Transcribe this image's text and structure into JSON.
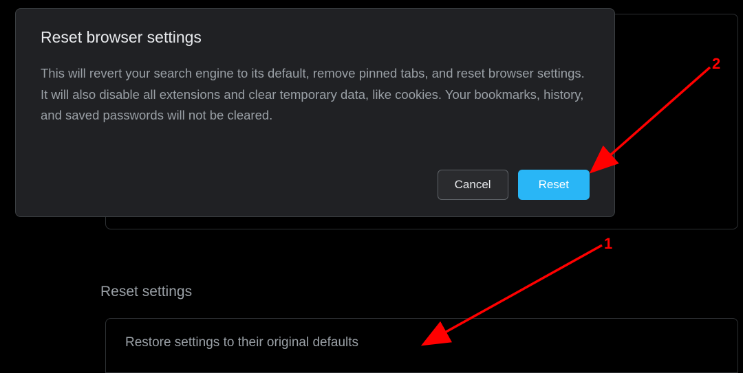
{
  "dialog": {
    "title": "Reset browser settings",
    "body": "This will revert your search engine to its default, remove pinned tabs, and reset browser settings. It will also disable all extensions and clear temporary data, like cookies. Your bookmarks, history, and saved passwords will not be cleared.",
    "cancel_label": "Cancel",
    "reset_label": "Reset"
  },
  "section": {
    "title": "Reset settings",
    "row_text": "Restore settings to their original defaults"
  },
  "annotations": {
    "label1": "1",
    "label2": "2"
  }
}
